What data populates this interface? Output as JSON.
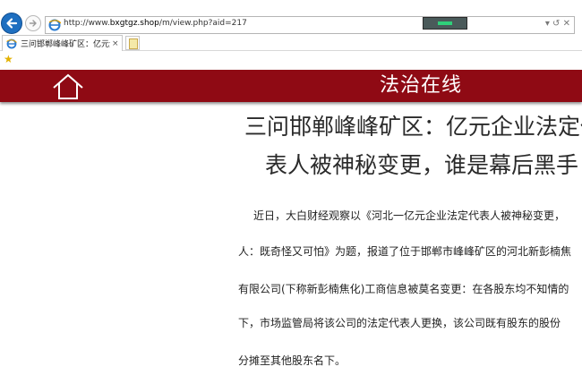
{
  "browser": {
    "url_prefix": "http://www.",
    "url_host": "bxgtgz.shop",
    "url_path": "/m/view.php?aid=217",
    "address_tools": "▾ ↺ ✕",
    "tab_title": "三问邯郸峰峰矿区：亿元企...",
    "tab_close": "×",
    "favorites_icon": "star-icon"
  },
  "header": {
    "site_title": "法治在线",
    "home_icon": "home-icon",
    "background_color": "#8f0a14"
  },
  "article": {
    "title_lines": [
      "三问邯郸峰峰矿区：亿元企业法定代",
      "表人被神秘变更，谁是幕后黑手"
    ],
    "body_lines": [
      "近日，大白财经观察以《河北一亿元企业法定代表人被神秘变更，",
      "人：既奇怪又可怕》为题，报道了位于邯郸市峰峰矿区的河北新彭楠焦",
      "有限公司(下称新彭楠焦化)工商信息被莫名变更：在各股东均不知情的",
      "下，市场监管局将该公司的法定代表人更换，该公司既有股东的股份",
      "分摊至其他股东名下。"
    ]
  }
}
